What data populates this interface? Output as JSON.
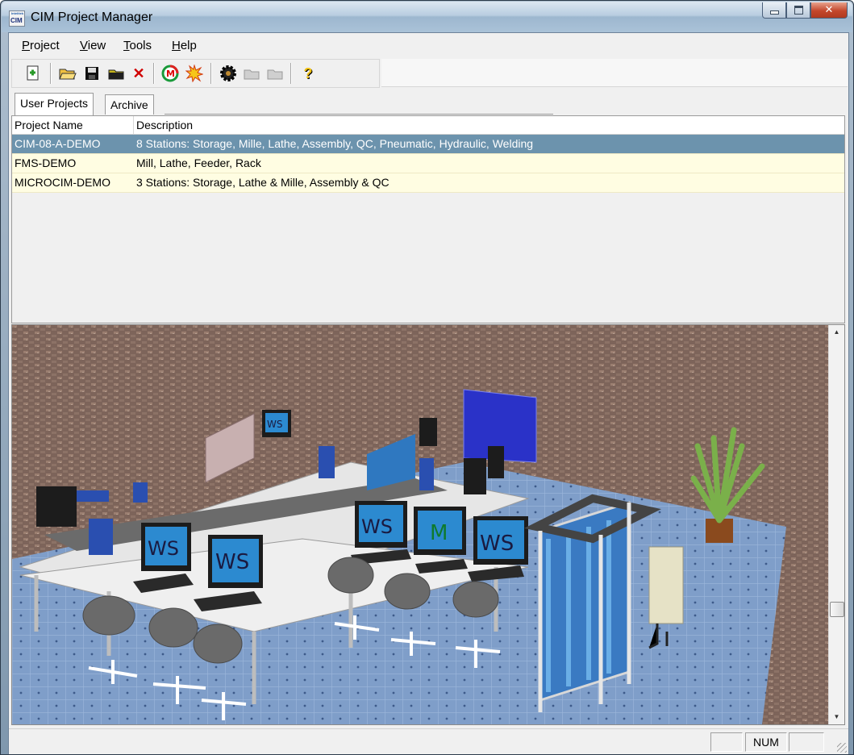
{
  "window": {
    "title": "CIM Project Manager",
    "app_icon_text_top": "Intelitek",
    "app_icon_text_bottom": "CIM"
  },
  "menu": [
    {
      "label": "Project",
      "underline": "P",
      "rest": "roject"
    },
    {
      "label": "View",
      "underline": "V",
      "rest": "iew"
    },
    {
      "label": "Tools",
      "underline": "T",
      "rest": "ools"
    },
    {
      "label": "Help",
      "underline": "H",
      "rest": "elp"
    }
  ],
  "toolbar": {
    "icons": [
      "new-project-icon",
      "open-folder-icon",
      "save-disk-icon",
      "folder-move-icon",
      "delete-x-icon",
      "manufacturing-m-icon",
      "explode-star-icon",
      "gear-wheel-icon",
      "folder-disabled-icon",
      "folder-disabled-icon-2",
      "help-question-icon"
    ]
  },
  "tabs": {
    "user_projects": "User Projects",
    "archive": "Archive"
  },
  "list": {
    "headers": {
      "name": "Project Name",
      "description": "Description"
    },
    "rows": [
      {
        "name": "CIM-08-A-DEMO",
        "description": "8 Stations: Storage, Mille, Lathe, Assembly, QC, Pneumatic, Hydraulic, Welding",
        "selected": true
      },
      {
        "name": "FMS-DEMO",
        "description": "Mill, Lathe, Feeder, Rack",
        "selected": false
      },
      {
        "name": "MICROCIM-DEMO",
        "description": "3 Stations: Storage, Lathe & Mille, Assembly & QC",
        "selected": false
      }
    ]
  },
  "scene": {
    "monitor_labels": [
      "WS",
      "WS",
      "WS",
      "WS",
      "M",
      "WS"
    ],
    "colors": {
      "floor_tile": "#7f9cc8",
      "brick": "#8a6a5a",
      "table": "#dcdcdc",
      "robot": "#2a4fb0",
      "monitor_screen": "#2c8ad0",
      "selection": "#6c93ad",
      "row_bg": "#fffde2"
    }
  },
  "status": {
    "pane1": "",
    "num": "NUM",
    "pane3": ""
  }
}
